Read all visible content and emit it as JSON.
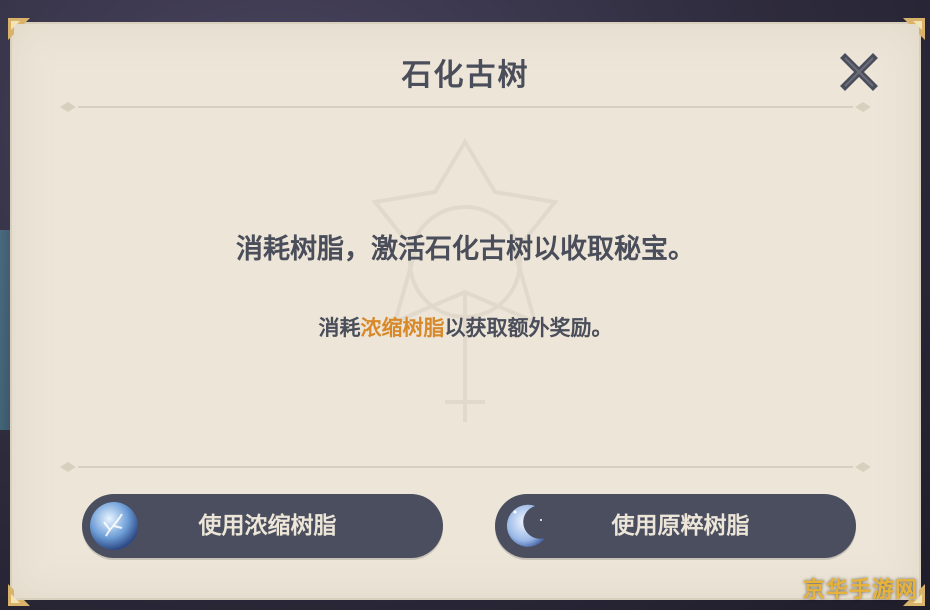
{
  "dialog": {
    "title": "石化古树",
    "message": "消耗树脂，激活石化古树以收取秘宝。",
    "sub_message": {
      "prefix": "消耗",
      "highlight": "浓缩树脂",
      "suffix": "以获取额外奖励。"
    },
    "close_icon": "close-icon",
    "highlight_color": "#d8892a"
  },
  "buttons": {
    "condensed": {
      "label": "使用浓缩树脂",
      "icon": "condensed-resin-icon"
    },
    "original": {
      "label": "使用原粹树脂",
      "icon": "original-resin-icon"
    }
  },
  "watermark": "京华手游网"
}
